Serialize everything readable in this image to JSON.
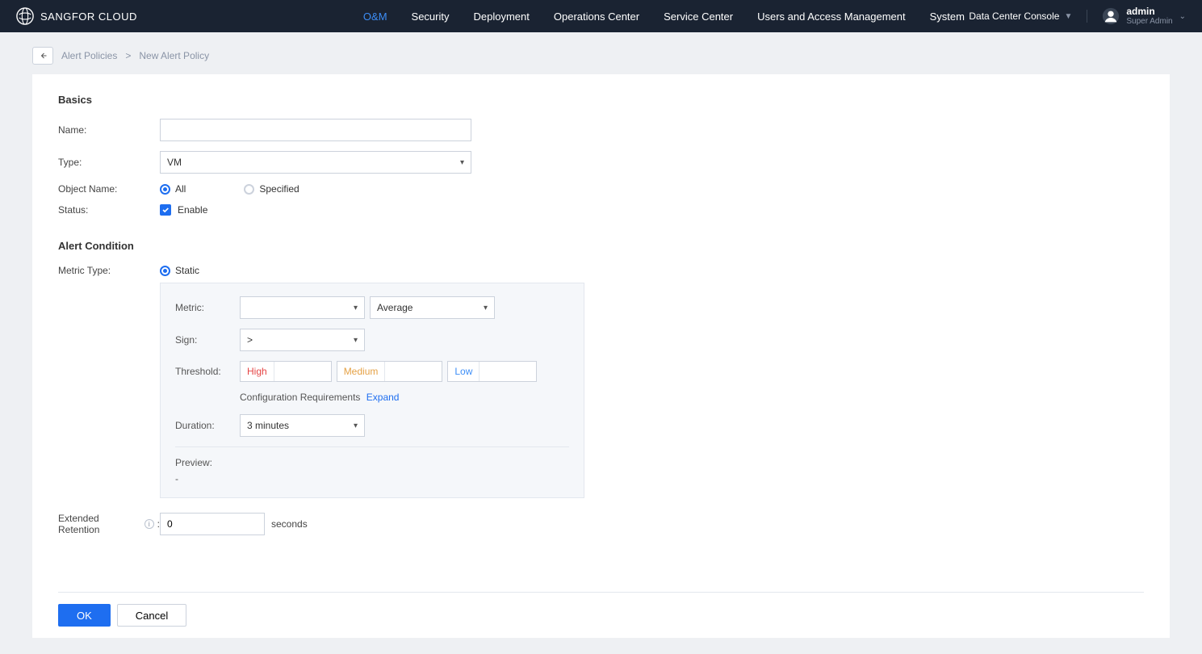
{
  "brand": "SANGFOR CLOUD",
  "nav": {
    "items": [
      "O&M",
      "Security",
      "Deployment",
      "Operations Center",
      "Service Center",
      "Users and Access Management",
      "System"
    ],
    "active_index": 0
  },
  "topbar": {
    "console": "Data Center Console",
    "user": {
      "name": "admin",
      "role": "Super Admin"
    }
  },
  "breadcrumb": {
    "parent": "Alert Policies",
    "sep": ">",
    "current": "New Alert Policy"
  },
  "sections": {
    "basics": "Basics",
    "condition": "Alert Condition"
  },
  "labels": {
    "name": "Name:",
    "type": "Type:",
    "object_name": "Object Name:",
    "status": "Status:",
    "metric_type": "Metric Type:",
    "metric": "Metric:",
    "sign": "Sign:",
    "threshold": "Threshold:",
    "duration": "Duration:",
    "preview": "Preview:",
    "ext_retention": "Extended Retention",
    "seconds": "seconds",
    "config_req": "Configuration Requirements",
    "expand": "Expand"
  },
  "values": {
    "name_value": "",
    "type_select": "VM",
    "object_all": "All",
    "object_specified": "Specified",
    "status_enable": "Enable",
    "metric_static": "Static",
    "metric_select": "",
    "agg_select": "Average",
    "sign_select": ">",
    "thresh_high": "High",
    "thresh_med": "Medium",
    "thresh_low": "Low",
    "thresh_high_val": "",
    "thresh_med_val": "",
    "thresh_low_val": "",
    "duration_select": "3 minutes",
    "preview_value": "-",
    "ext_value": "0"
  },
  "buttons": {
    "ok": "OK",
    "cancel": "Cancel"
  }
}
